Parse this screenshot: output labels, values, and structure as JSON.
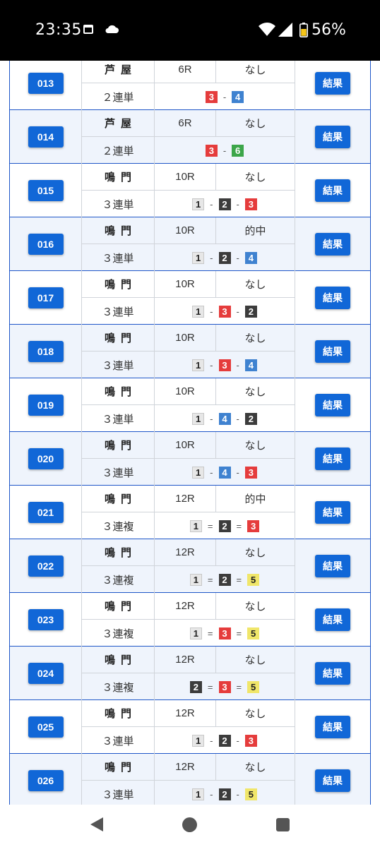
{
  "status_bar": {
    "time": "23:35",
    "battery_pct": "56%",
    "icons": [
      "calendar-icon",
      "cloud-icon",
      "wifi-icon",
      "signal-icon",
      "battery-icon"
    ]
  },
  "colors": {
    "accent": "#1167d7",
    "row_alt": "#eff4fc",
    "border": "#1e56c8"
  },
  "result_label": "結果",
  "rows": [
    {
      "id": "013",
      "venue": "芦屋",
      "race": "6R",
      "result": "なし",
      "bet_type": "２連単",
      "combo": [
        3,
        4
      ],
      "sep": "-"
    },
    {
      "id": "014",
      "venue": "芦屋",
      "race": "6R",
      "result": "なし",
      "bet_type": "２連単",
      "combo": [
        3,
        6
      ],
      "sep": "-"
    },
    {
      "id": "015",
      "venue": "鳴門",
      "race": "10R",
      "result": "なし",
      "bet_type": "３連単",
      "combo": [
        1,
        2,
        3
      ],
      "sep": "-"
    },
    {
      "id": "016",
      "venue": "鳴門",
      "race": "10R",
      "result": "的中",
      "bet_type": "３連単",
      "combo": [
        1,
        2,
        4
      ],
      "sep": "-"
    },
    {
      "id": "017",
      "venue": "鳴門",
      "race": "10R",
      "result": "なし",
      "bet_type": "３連単",
      "combo": [
        1,
        3,
        2
      ],
      "sep": "-"
    },
    {
      "id": "018",
      "venue": "鳴門",
      "race": "10R",
      "result": "なし",
      "bet_type": "３連単",
      "combo": [
        1,
        3,
        4
      ],
      "sep": "-"
    },
    {
      "id": "019",
      "venue": "鳴門",
      "race": "10R",
      "result": "なし",
      "bet_type": "３連単",
      "combo": [
        1,
        4,
        2
      ],
      "sep": "-"
    },
    {
      "id": "020",
      "venue": "鳴門",
      "race": "10R",
      "result": "なし",
      "bet_type": "３連単",
      "combo": [
        1,
        4,
        3
      ],
      "sep": "-"
    },
    {
      "id": "021",
      "venue": "鳴門",
      "race": "12R",
      "result": "的中",
      "bet_type": "３連複",
      "combo": [
        1,
        2,
        3
      ],
      "sep": "="
    },
    {
      "id": "022",
      "venue": "鳴門",
      "race": "12R",
      "result": "なし",
      "bet_type": "３連複",
      "combo": [
        1,
        2,
        5
      ],
      "sep": "="
    },
    {
      "id": "023",
      "venue": "鳴門",
      "race": "12R",
      "result": "なし",
      "bet_type": "３連複",
      "combo": [
        1,
        3,
        5
      ],
      "sep": "="
    },
    {
      "id": "024",
      "venue": "鳴門",
      "race": "12R",
      "result": "なし",
      "bet_type": "３連複",
      "combo": [
        2,
        3,
        5
      ],
      "sep": "="
    },
    {
      "id": "025",
      "venue": "鳴門",
      "race": "12R",
      "result": "なし",
      "bet_type": "３連単",
      "combo": [
        1,
        2,
        3
      ],
      "sep": "-"
    },
    {
      "id": "026",
      "venue": "鳴門",
      "race": "12R",
      "result": "なし",
      "bet_type": "３連単",
      "combo": [
        1,
        2,
        5
      ],
      "sep": "-"
    }
  ]
}
